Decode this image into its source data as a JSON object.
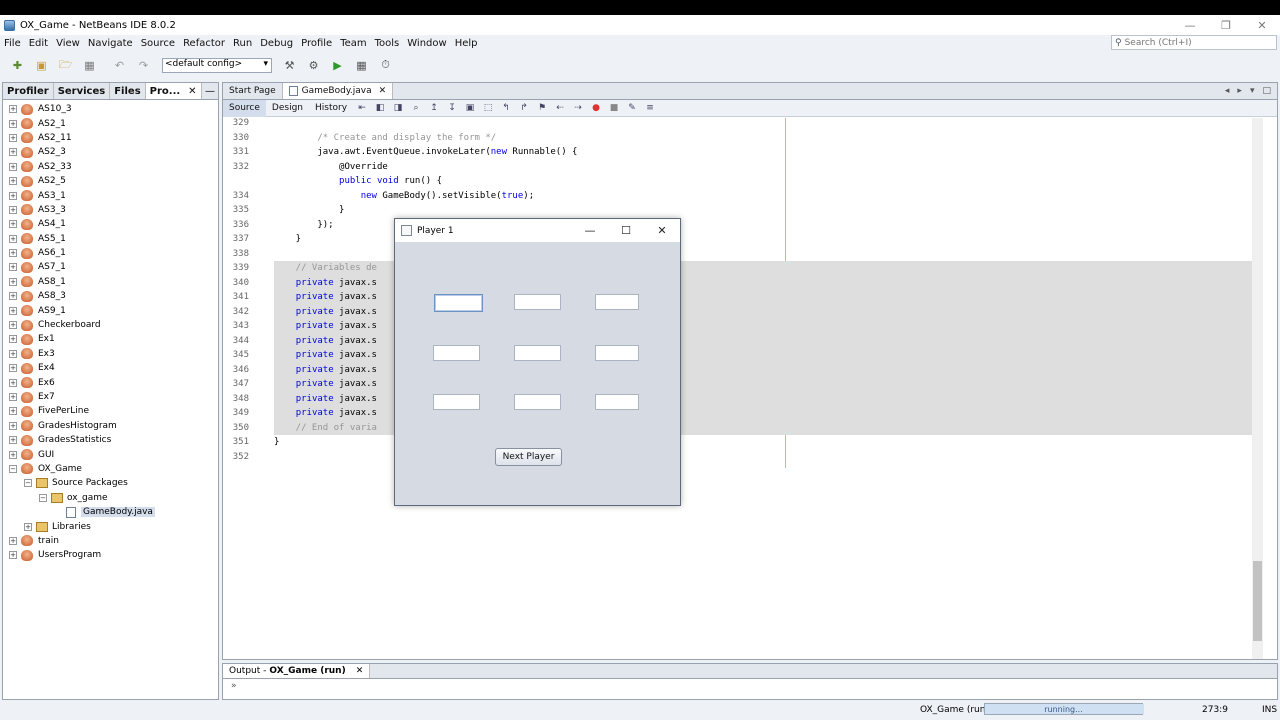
{
  "window": {
    "title": "OX_Game - NetBeans IDE 8.0.2",
    "controls": [
      "—",
      "❐",
      "✕"
    ]
  },
  "menu": [
    "File",
    "Edit",
    "View",
    "Navigate",
    "Source",
    "Refactor",
    "Run",
    "Debug",
    "Profile",
    "Team",
    "Tools",
    "Window",
    "Help"
  ],
  "search": {
    "placeholder": "Search (Ctrl+I)"
  },
  "toolbar": {
    "config": "<default config>"
  },
  "left_panel": {
    "tabs": [
      "Profiler",
      "Services",
      "Files",
      "Pro..."
    ],
    "tree": [
      {
        "label": "AS10_3",
        "type": "project",
        "depth": 0,
        "exp": "+"
      },
      {
        "label": "AS2_1",
        "type": "project",
        "depth": 0,
        "exp": "+"
      },
      {
        "label": "AS2_11",
        "type": "project",
        "depth": 0,
        "exp": "+"
      },
      {
        "label": "AS2_3",
        "type": "project",
        "depth": 0,
        "exp": "+"
      },
      {
        "label": "AS2_33",
        "type": "project",
        "depth": 0,
        "exp": "+"
      },
      {
        "label": "AS2_5",
        "type": "project",
        "depth": 0,
        "exp": "+"
      },
      {
        "label": "AS3_1",
        "type": "project",
        "depth": 0,
        "exp": "+"
      },
      {
        "label": "AS3_3",
        "type": "project",
        "depth": 0,
        "exp": "+"
      },
      {
        "label": "AS4_1",
        "type": "project",
        "depth": 0,
        "exp": "+"
      },
      {
        "label": "AS5_1",
        "type": "project",
        "depth": 0,
        "exp": "+"
      },
      {
        "label": "AS6_1",
        "type": "project",
        "depth": 0,
        "exp": "+"
      },
      {
        "label": "AS7_1",
        "type": "project",
        "depth": 0,
        "exp": "+"
      },
      {
        "label": "AS8_1",
        "type": "project",
        "depth": 0,
        "exp": "+"
      },
      {
        "label": "AS8_3",
        "type": "project",
        "depth": 0,
        "exp": "+"
      },
      {
        "label": "AS9_1",
        "type": "project",
        "depth": 0,
        "exp": "+"
      },
      {
        "label": "Checkerboard",
        "type": "project",
        "depth": 0,
        "exp": "+"
      },
      {
        "label": "Ex1",
        "type": "project",
        "depth": 0,
        "exp": "+"
      },
      {
        "label": "Ex3",
        "type": "project",
        "depth": 0,
        "exp": "+"
      },
      {
        "label": "Ex4",
        "type": "project",
        "depth": 0,
        "exp": "+"
      },
      {
        "label": "Ex6",
        "type": "project",
        "depth": 0,
        "exp": "+"
      },
      {
        "label": "Ex7",
        "type": "project",
        "depth": 0,
        "exp": "+"
      },
      {
        "label": "FivePerLine",
        "type": "project",
        "depth": 0,
        "exp": "+"
      },
      {
        "label": "GradesHistogram",
        "type": "project",
        "depth": 0,
        "exp": "+"
      },
      {
        "label": "GradesStatistics",
        "type": "project",
        "depth": 0,
        "exp": "+"
      },
      {
        "label": "GUI",
        "type": "project",
        "depth": 0,
        "exp": "+"
      },
      {
        "label": "OX_Game",
        "type": "project",
        "depth": 0,
        "exp": "−"
      },
      {
        "label": "Source Packages",
        "type": "pkg",
        "depth": 1,
        "exp": "−"
      },
      {
        "label": "ox_game",
        "type": "pkg",
        "depth": 2,
        "exp": "−"
      },
      {
        "label": "GameBody.java",
        "type": "file",
        "depth": 3,
        "exp": ""
      },
      {
        "label": "Libraries",
        "type": "pkg",
        "depth": 1,
        "exp": "+"
      },
      {
        "label": "train",
        "type": "project",
        "depth": 0,
        "exp": "+"
      },
      {
        "label": "UsersProgram",
        "type": "project",
        "depth": 0,
        "exp": "+"
      }
    ]
  },
  "editor": {
    "tabs": [
      {
        "label": "Start Page",
        "active": false
      },
      {
        "label": "GameBody.java",
        "active": true
      }
    ],
    "views": [
      "Source",
      "Design",
      "History"
    ],
    "lines": [
      {
        "n": "329",
        "text": "        ",
        "g": false,
        "kind": "code"
      },
      {
        "n": "330",
        "text": "        /* Create and display the form */",
        "g": false,
        "kind": "comment"
      },
      {
        "n": "331",
        "text": "        java.awt.EventQueue.invokeLater(new Runnable() {",
        "g": false,
        "kind": "code"
      },
      {
        "n": "332",
        "text": "            @Override",
        "g": false,
        "kind": "code"
      },
      {
        "n": "",
        "text": "            public void run() {",
        "g": false,
        "kind": "code"
      },
      {
        "n": "334",
        "text": "                new GameBody().setVisible(true);",
        "g": false,
        "kind": "code"
      },
      {
        "n": "335",
        "text": "            }",
        "g": false,
        "kind": "code"
      },
      {
        "n": "336",
        "text": "        });",
        "g": false,
        "kind": "code"
      },
      {
        "n": "337",
        "text": "    }",
        "g": false,
        "kind": "code"
      },
      {
        "n": "338",
        "text": "",
        "g": false,
        "kind": "code"
      },
      {
        "n": "339",
        "text": "    // Variables de",
        "g": true,
        "kind": "comment"
      },
      {
        "n": "340",
        "text": "    private javax.s",
        "g": true,
        "kind": "private"
      },
      {
        "n": "341",
        "text": "    private javax.s",
        "g": true,
        "kind": "private"
      },
      {
        "n": "342",
        "text": "    private javax.s",
        "g": true,
        "kind": "private"
      },
      {
        "n": "343",
        "text": "    private javax.s",
        "g": true,
        "kind": "private"
      },
      {
        "n": "344",
        "text": "    private javax.s",
        "g": true,
        "kind": "private"
      },
      {
        "n": "345",
        "text": "    private javax.s",
        "g": true,
        "kind": "private"
      },
      {
        "n": "346",
        "text": "    private javax.s",
        "g": true,
        "kind": "private"
      },
      {
        "n": "347",
        "text": "    private javax.s",
        "g": true,
        "kind": "private"
      },
      {
        "n": "348",
        "text": "    private javax.s",
        "g": true,
        "kind": "private"
      },
      {
        "n": "349",
        "text": "    private javax.s",
        "g": true,
        "kind": "private"
      },
      {
        "n": "350",
        "text": "    // End of varia",
        "g": true,
        "kind": "comment"
      },
      {
        "n": "351",
        "text": "}",
        "g": false,
        "kind": "code"
      },
      {
        "n": "352",
        "text": "",
        "g": false,
        "kind": "code"
      }
    ]
  },
  "output": {
    "prefix": "Output - ",
    "name": "OX_Game (run)"
  },
  "statusbar": {
    "process": "OX_Game (run)",
    "progress_text": "running...",
    "position": "273:9",
    "mode": "INS"
  },
  "dialog": {
    "title": "Player 1",
    "cells": [
      "",
      "",
      "",
      "",
      "",
      "",
      "",
      "",
      ""
    ],
    "button": "Next Player"
  }
}
